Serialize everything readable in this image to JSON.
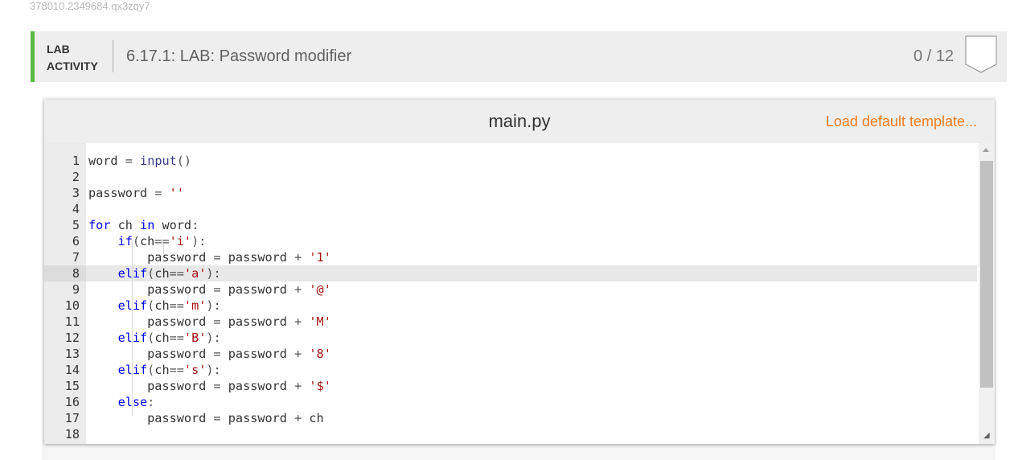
{
  "page": {
    "id_text": "378010.2349684.qx3zqy7"
  },
  "lab": {
    "label_line1": "LAB",
    "label_line2": "ACTIVITY",
    "title": "6.17.1: LAB: Password modifier",
    "score": "0 / 12",
    "badge_icon": "shield-badge-icon",
    "accent_color": "#5aba47"
  },
  "editor": {
    "file_name": "main.py",
    "load_template_label": "Load default template...",
    "link_color": "#f47c20",
    "active_line": 8,
    "line_numbers": [
      "1",
      "2",
      "3",
      "4",
      "5",
      "6",
      "7",
      "8",
      "9",
      "10",
      "11",
      "12",
      "13",
      "14",
      "15",
      "16",
      "17",
      "18"
    ],
    "code_lines": [
      "word = input()",
      "",
      "password = ''",
      "",
      "for ch in word:",
      "    if(ch=='i'):",
      "        password = password + '1'",
      "    elif(ch=='a'):",
      "        password = password + '@'",
      "    elif(ch=='m'):",
      "        password = password + 'M'",
      "    elif(ch=='B'):",
      "        password = password + '8'",
      "    elif(ch=='s'):",
      "        password = password + '$'",
      "    else:",
      "        password = password + ch",
      ""
    ]
  }
}
